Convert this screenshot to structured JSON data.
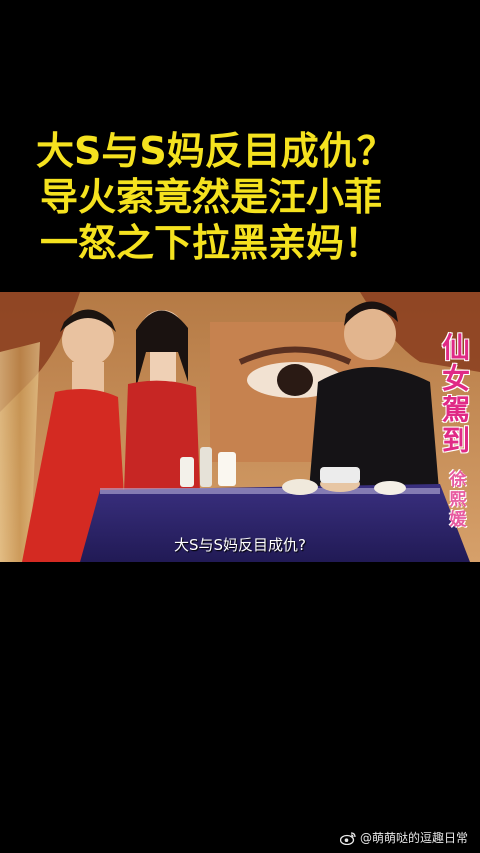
{
  "headline": {
    "line1": "大S与S妈反目成仇？",
    "line2": "导火索竟然是汪小菲",
    "line3": "一怒之下拉黑亲妈！"
  },
  "video": {
    "show_logo_chars": [
      "仙",
      "女",
      "駕",
      "到"
    ],
    "guest_name_chars": [
      "徐",
      "熙",
      "媛"
    ],
    "subtitle": "大S与S妈反目成仇?"
  },
  "watermark": {
    "icon": "weibo-icon",
    "text": "@萌萌哒的逗趣日常"
  },
  "colors": {
    "headline": "#f5e21f",
    "background": "#000000",
    "logo": "#e02a86"
  }
}
